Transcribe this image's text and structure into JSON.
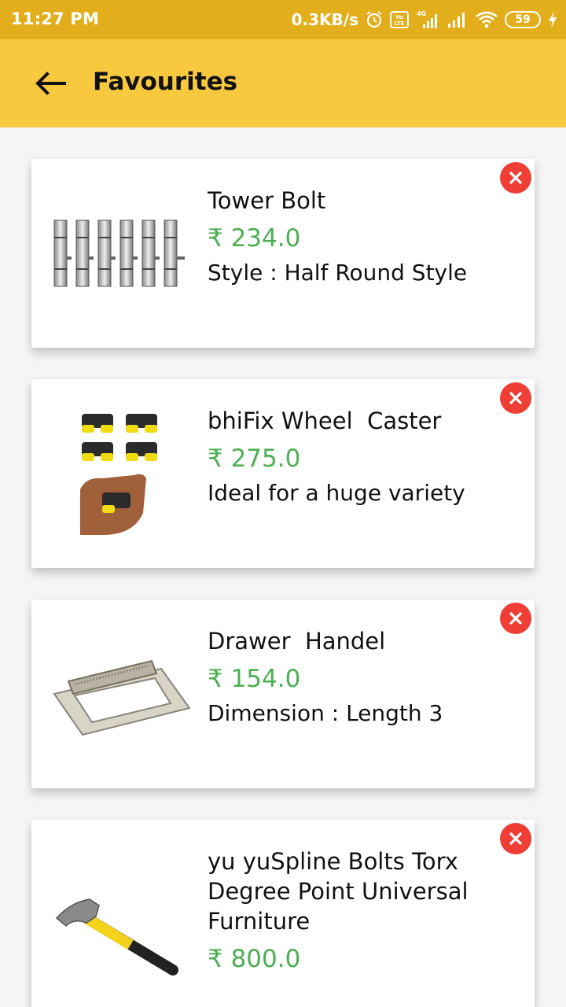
{
  "status_bar": {
    "time": "11:27 PM",
    "speed": "0.3KB/s",
    "network": "4G",
    "battery": "59",
    "icons": [
      "alarm-icon",
      "volte-icon",
      "signal-4g-icon",
      "signal-icon",
      "wifi-icon",
      "battery-icon",
      "charging-icon"
    ]
  },
  "header": {
    "title": "Favourites",
    "back_icon": "arrow-left-icon"
  },
  "colors": {
    "status_bar": "#e3ae1c",
    "app_bar": "#f8c93f",
    "price": "#4caf50",
    "remove": "#ef3e36"
  },
  "favourites": [
    {
      "name": "Tower Bolt",
      "price": "₹ 234.0",
      "description": "Style : Half Round Style",
      "image": "tower-bolt-image"
    },
    {
      "name": "bhiFix Wheel  Caster",
      "price": "₹ 275.0",
      "description": "Ideal for a huge variety",
      "image": "wheel-caster-image"
    },
    {
      "name": "Drawer  Handel",
      "price": "₹ 154.0",
      "description": "Dimension : Length 3",
      "image": "drawer-handle-image"
    },
    {
      "name": "yu yuSpline Bolts Torx Degree Point Universal Furniture",
      "price": "₹ 800.0",
      "description": "",
      "image": "hammer-image"
    }
  ]
}
